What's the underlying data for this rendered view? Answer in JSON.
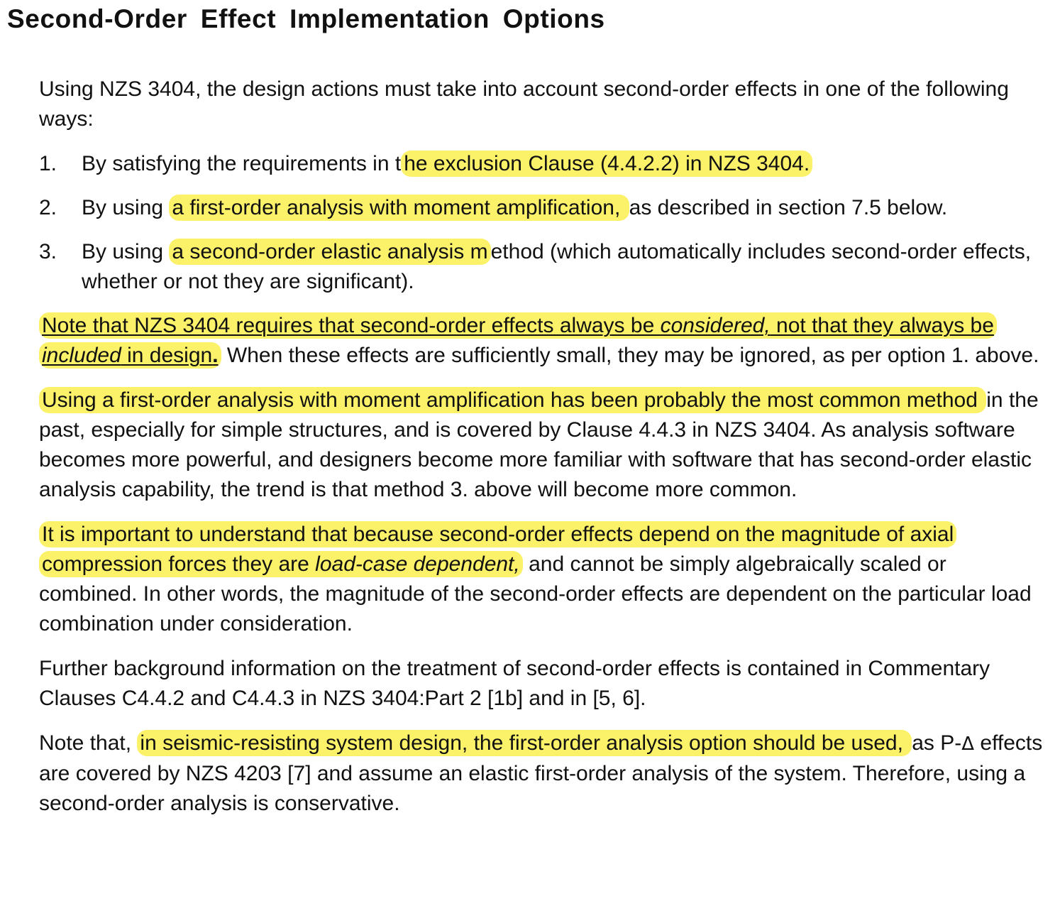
{
  "title": "Second-Order  Effect  Implementation  Options",
  "intro": {
    "text": "Using NZS 3404, the design actions must take into account second-order effects in one of the following ways:"
  },
  "list": [
    {
      "number": "1.",
      "pre": "By satisfying the requirements in t",
      "highlight": "he exclusion Clause (4.4.2.2) in NZS 3404.",
      "post": ""
    },
    {
      "number": "2.",
      "pre": "By using ",
      "highlight": "a first-order analysis with moment amplification, ",
      "post": "as described in section 7.5 below."
    },
    {
      "number": "3.",
      "pre": "By using ",
      "highlight": "a second-order elastic analysis m",
      "post": "ethod (which automatically includes second-order effects, whether or not they are significant)."
    }
  ],
  "note1": {
    "hl_a": "Note that NZS 3404 requires that second-order effects always be ",
    "hl_b_italic": "considered,",
    "hl_c": " not that they always be ",
    "hl_d_italic": "included",
    "hl_e": " in design",
    "hl_f_bold": ".",
    "rest": "  When these effects are sufficiently small, they may be ignored, as per option 1.  above."
  },
  "para_method": {
    "hl": "Using a first-order analysis with moment amplification has been probably the most common method ",
    "rest": "in the past, especially for simple structures, and is covered by Clause 4.4.3 in NZS 3404.   As analysis software becomes more powerful, and designers become more familiar with software that has second-order elastic analysis capability, the trend is that method 3. above will become more common."
  },
  "para_important": {
    "hl_a": "It is important to understand that because second-order effects depend on the magnitude of axial compression forces they are ",
    "hl_b_italic": "load-case dependent,",
    "rest": "  and cannot be simply algebraically scaled or combined.   In other words, the magnitude of the second-order effects are dependent on the particular load combination under consideration."
  },
  "para_background": {
    "text": "Further background information on the treatment of second-order effects is contained in Commentary Clauses C4.4.2 and C4.4.3 in NZS 3404:Part 2 [1b] and in [5, 6]."
  },
  "para_seismic": {
    "pre": "Note that, ",
    "hl": "in seismic-resisting system design, the first-order analysis option should be used, ",
    "mid": "as P-",
    "delta": "Δ",
    "post": " effects are covered by NZS 4203 [7] and assume an elastic first-order analysis of the system.   Therefore, using a second-order analysis is conservative."
  },
  "colors": {
    "highlight": "#fbf26a",
    "text": "#111111"
  }
}
